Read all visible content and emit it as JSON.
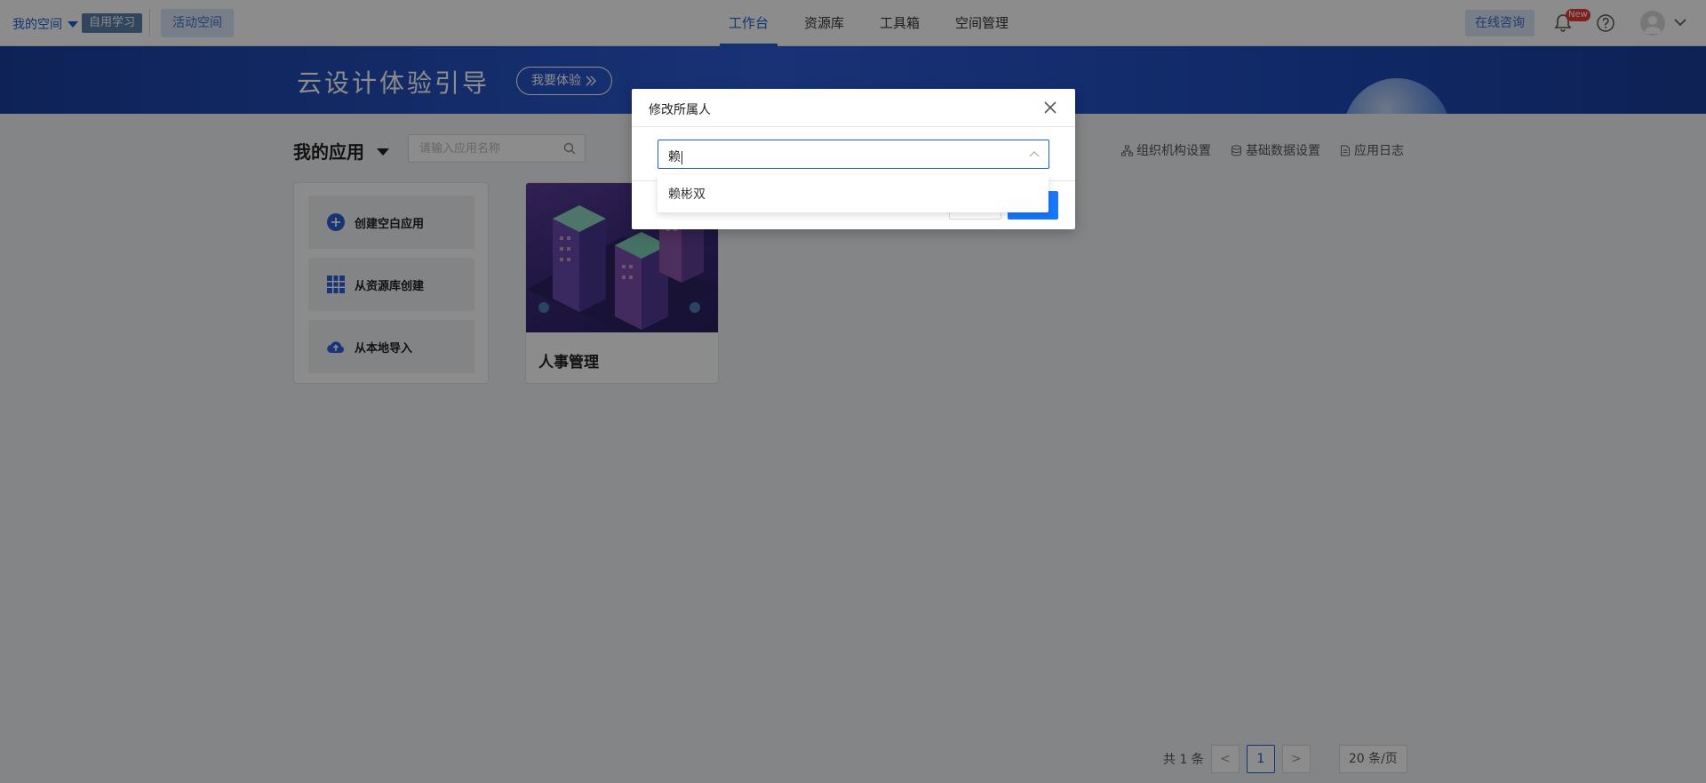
{
  "topbar": {
    "space_label": "我的空间",
    "tag_label": "自用学习",
    "activity_label": "活动空间",
    "tabs": [
      {
        "label": "工作台",
        "active": true
      },
      {
        "label": "资源库",
        "active": false
      },
      {
        "label": "工具箱",
        "active": false
      },
      {
        "label": "空间管理",
        "active": false
      }
    ],
    "consult_label": "在线咨询",
    "new_badge": "New",
    "accent": "#1a60d6"
  },
  "banner": {
    "title": "云设计体验引导",
    "button_label": "我要体验"
  },
  "apps": {
    "title": "我的应用",
    "search_placeholder": "请输入应用名称",
    "links": [
      {
        "label": "组织机构设置",
        "icon": "org-icon"
      },
      {
        "label": "基础数据设置",
        "icon": "database-icon"
      },
      {
        "label": "应用日志",
        "icon": "log-icon"
      }
    ],
    "create_items": [
      {
        "label": "创建空白应用",
        "icon": "plus-circle-icon"
      },
      {
        "label": "从资源库创建",
        "icon": "grid-icon"
      },
      {
        "label": "从本地导入",
        "icon": "cloud-upload-icon"
      }
    ],
    "cards": [
      {
        "name": "人事管理"
      }
    ]
  },
  "pagination": {
    "total_text": "共 1 条",
    "prev": "<",
    "current_page": "1",
    "next": ">",
    "page_size": "20 条/页"
  },
  "dialog": {
    "title": "修改所属人",
    "select_value": "赖",
    "options": [
      "赖彬双"
    ],
    "primary_color": "#1677ff"
  }
}
